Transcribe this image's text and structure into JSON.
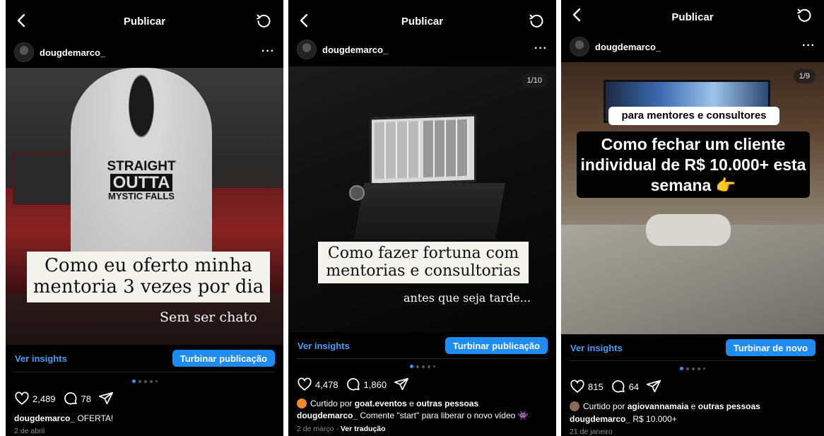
{
  "posts": [
    {
      "header_title": "Publicar",
      "username": "dougdemarco_",
      "hoodie_text": [
        "STRAIGHT",
        "OUTTA",
        "MYSTIC FALLS"
      ],
      "overlay_title": "Como eu oferto minha mentoria 3 vezes por dia",
      "overlay_sub": "Sem ser chato",
      "insights_label": "Ver insights",
      "boost_label": "Turbinar publicação",
      "likes": "2,489",
      "comments": "78",
      "caption_user": "dougdemarco_",
      "caption_text": "OFERTA!",
      "date": "2 de abril"
    },
    {
      "header_title": "Publicar",
      "username": "dougdemarco_",
      "counter": "1/10",
      "overlay_title": "Como fazer fortuna com mentorias e consultorias",
      "overlay_sub": "antes que seja tarde...",
      "insights_label": "Ver insights",
      "boost_label": "Turbinar publicação",
      "likes": "4,478",
      "comments": "1,860",
      "liked_prefix": "Curtido por",
      "liked_user": "goat.eventos",
      "liked_conj": "e",
      "liked_others": "outras pessoas",
      "caption_user": "dougdemarco_",
      "caption_text": "Comente \"start\" para liberar o novo vídeo 👾",
      "date": "2 de março",
      "date_sep": "·",
      "translate_label": "Ver tradução"
    },
    {
      "header_title": "Publicar",
      "username": "dougdemarco_",
      "counter": "1/9",
      "tag_text": "para mentores e consultores",
      "overlay_title": "Como fechar um cliente individual de R$ 10.000+ esta semana 👉",
      "insights_label": "Ver insights",
      "boost_label": "Turbinar de novo",
      "likes": "815",
      "comments": "64",
      "liked_prefix": "Curtido por",
      "liked_user": "agiovannamaia",
      "liked_conj": "e",
      "liked_others": "outras pessoas",
      "caption_user": "dougdemarco_",
      "caption_text": "R$ 10.000+",
      "date": "21 de janeiro"
    }
  ],
  "colors": {
    "background": "#000000",
    "link_blue": "#4b9cf5",
    "button_blue": "#1f8cf2",
    "muted": "#8e8e8e"
  },
  "icons": [
    "back-icon",
    "refresh-icon",
    "more-icon",
    "heart-icon",
    "comment-icon",
    "share-icon"
  ]
}
